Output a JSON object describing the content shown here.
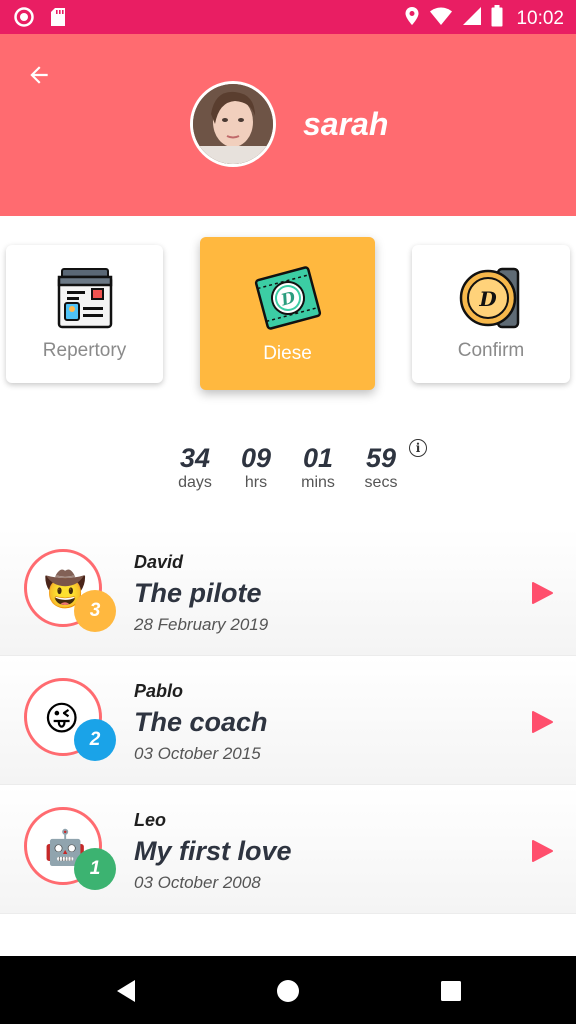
{
  "status_bar": {
    "time": "10:02",
    "left_icons": [
      "record-icon",
      "sd-card-icon"
    ],
    "right_icons": [
      "location-icon",
      "wifi-icon",
      "signal-icon",
      "battery-icon"
    ]
  },
  "header": {
    "username": "sarah",
    "colors": {
      "status_bar": "#e91e63",
      "header": "#ff6b70"
    }
  },
  "categories": [
    {
      "label": "Repertory",
      "icon": "id-card-icon",
      "active": false
    },
    {
      "label": "Diese",
      "icon": "ticket-icon",
      "active": true
    },
    {
      "label": "Confirm",
      "icon": "coin-icon",
      "active": false
    }
  ],
  "countdown": {
    "days": "34",
    "days_label": "days",
    "hrs": "09",
    "hrs_label": "hrs",
    "mins": "01",
    "mins_label": "mins",
    "secs": "59",
    "secs_label": "secs"
  },
  "entries": [
    {
      "name": "David",
      "title": "The pilote",
      "date": "28 February 2019",
      "rank": "3",
      "emoji": "🤠",
      "rank_color": "#ffb83f"
    },
    {
      "name": "Pablo",
      "title": "The coach",
      "date": "03 October 2015",
      "rank": "2",
      "emoji": "😜",
      "rank_color": "#1aa3e8"
    },
    {
      "name": "Leo",
      "title": "My first love",
      "date": "03 October 2008",
      "rank": "1",
      "emoji": "🤖",
      "rank_color": "#3cb371"
    }
  ],
  "accent": "#ff4f6d"
}
